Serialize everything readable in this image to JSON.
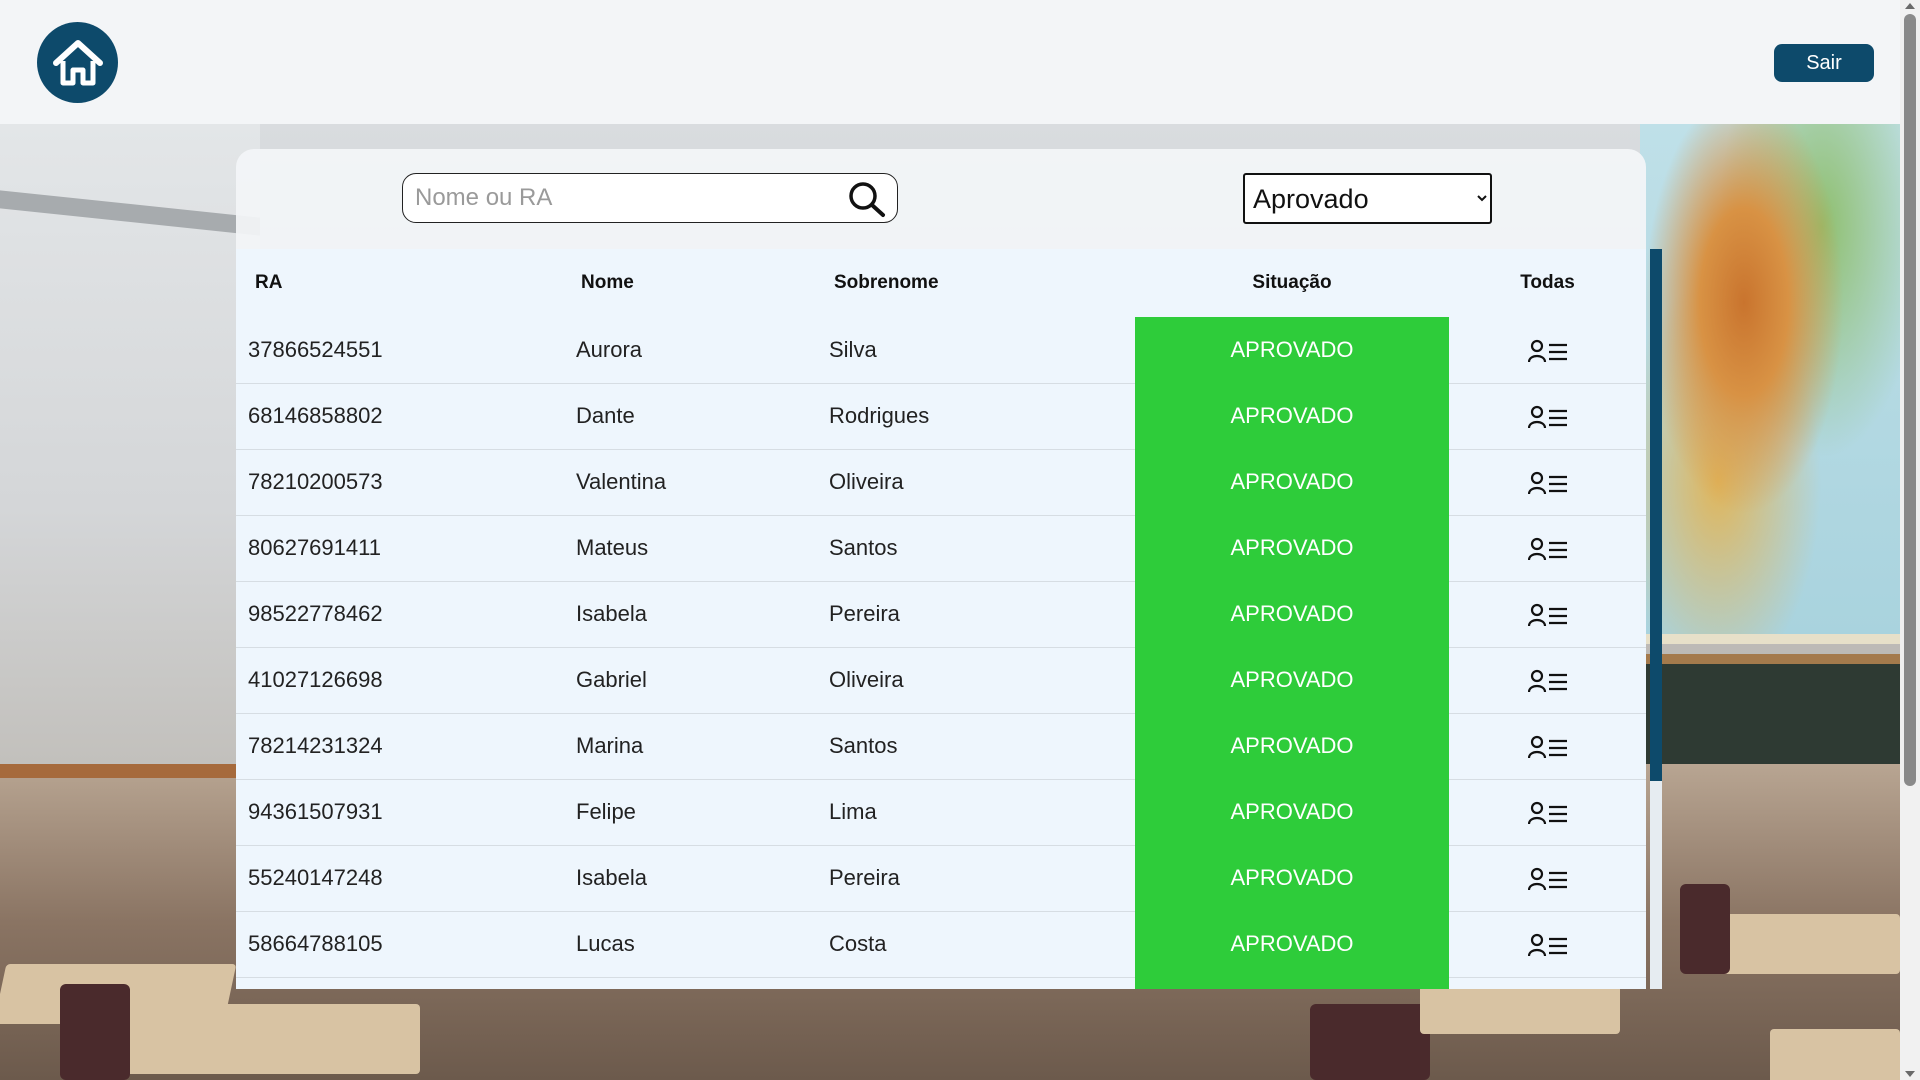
{
  "header": {
    "home_icon": "home-icon",
    "logout_label": "Sair"
  },
  "search": {
    "placeholder": "Nome ou RA",
    "value": "",
    "icon": "search-icon"
  },
  "filter": {
    "selected": "Aprovado"
  },
  "table": {
    "columns": [
      "RA",
      "Nome",
      "Sobrenome",
      "Situação",
      "Todas"
    ],
    "status_color": "#2ecc3a",
    "row_icon": "user-list-icon",
    "rows": [
      {
        "ra": "37866524551",
        "nome": "Aurora",
        "sobrenome": "Silva",
        "situacao": "APROVADO"
      },
      {
        "ra": "68146858802",
        "nome": "Dante",
        "sobrenome": "Rodrigues",
        "situacao": "APROVADO"
      },
      {
        "ra": "78210200573",
        "nome": "Valentina",
        "sobrenome": "Oliveira",
        "situacao": "APROVADO"
      },
      {
        "ra": "80627691411",
        "nome": "Mateus",
        "sobrenome": "Santos",
        "situacao": "APROVADO"
      },
      {
        "ra": "98522778462",
        "nome": "Isabela",
        "sobrenome": "Pereira",
        "situacao": "APROVADO"
      },
      {
        "ra": "41027126698",
        "nome": "Gabriel",
        "sobrenome": "Oliveira",
        "situacao": "APROVADO"
      },
      {
        "ra": "78214231324",
        "nome": "Marina",
        "sobrenome": "Santos",
        "situacao": "APROVADO"
      },
      {
        "ra": "94361507931",
        "nome": "Felipe",
        "sobrenome": "Lima",
        "situacao": "APROVADO"
      },
      {
        "ra": "55240147248",
        "nome": "Isabela",
        "sobrenome": "Pereira",
        "situacao": "APROVADO"
      },
      {
        "ra": "58664788105",
        "nome": "Lucas",
        "sobrenome": "Costa",
        "situacao": "APROVADO"
      }
    ]
  },
  "colors": {
    "brand": "#0d4a6b",
    "approved": "#2ecc3a",
    "table_bg": "#eef6fd"
  }
}
